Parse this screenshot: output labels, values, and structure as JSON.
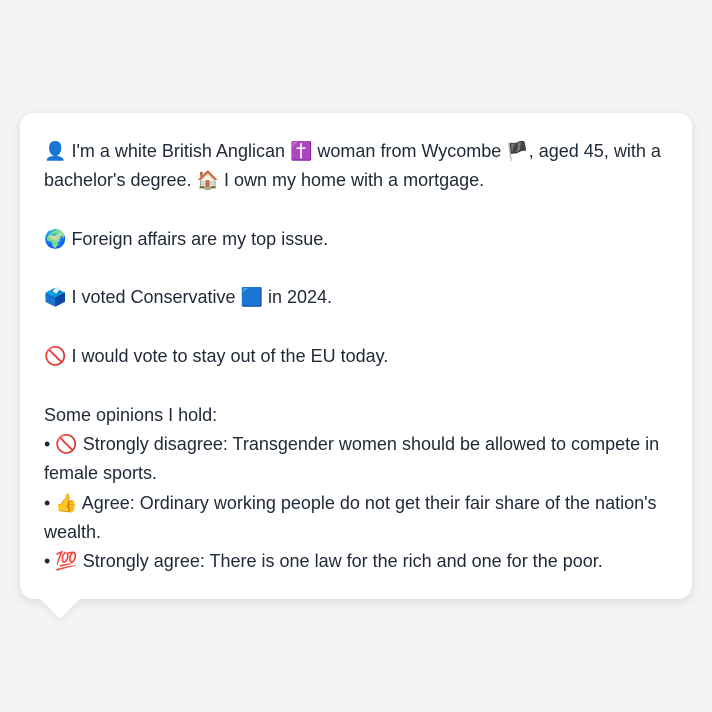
{
  "profile": {
    "line1_icon": "👤",
    "line1_a": "I'm a white British Anglican",
    "religion_icon": "✝️",
    "line1_b": "woman from Wycombe",
    "flag_icon": "🏴",
    "line1_c": ", aged 45, with a bachelor's degree.",
    "home_icon": "🏠",
    "line1_d": "I own my home with a mortgage."
  },
  "issue": {
    "icon": "🌍",
    "text": "Foreign affairs are my top issue."
  },
  "vote": {
    "icon": "🗳️",
    "text_a": "I voted Conservative",
    "party_icon": "🟦",
    "text_b": "in 2024."
  },
  "eu": {
    "icon": "🚫",
    "text": "I would vote to stay out of the EU today."
  },
  "opinions": {
    "heading": "Some opinions I hold:",
    "items": [
      {
        "bullet": "•",
        "icon": "🚫",
        "text": "Strongly disagree: Transgender women should be allowed to compete in female sports."
      },
      {
        "bullet": "•",
        "icon": "👍",
        "text": "Agree: Ordinary working people do not get their fair share of the nation's wealth."
      },
      {
        "bullet": "•",
        "icon": "💯",
        "text": "Strongly agree: There is one law for the rich and one for the poor."
      }
    ]
  }
}
